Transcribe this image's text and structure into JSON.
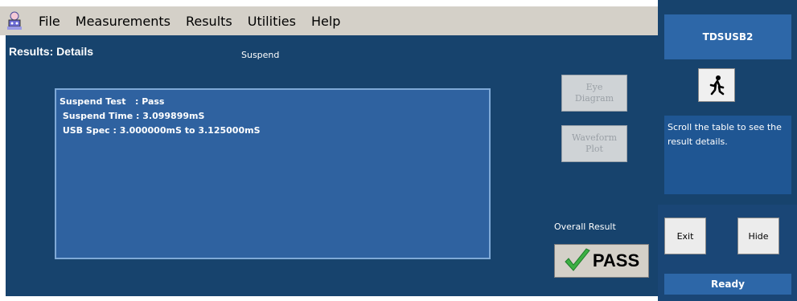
{
  "menubar": {
    "app_icon": "tektronix-robot-icon",
    "items": [
      "File",
      "Measurements",
      "Results",
      "Utilities",
      "Help"
    ]
  },
  "main": {
    "title": "Results: Details",
    "status_tag": "Suspend",
    "results_lines": [
      "Suspend Test   : Pass",
      " Suspend Time : 3.099899mS",
      " USB Spec : 3.000000mS to 3.125000mS"
    ],
    "eye_diagram": {
      "line1": "Eye",
      "line2": "Diagram"
    },
    "waveform_plot": {
      "line1": "Waveform",
      "line2": "Plot"
    },
    "overall_label": "Overall Result",
    "overall_value": "PASS"
  },
  "right_panel": {
    "app_name": "TDSUSB2",
    "run_icon": "running-man-icon",
    "help_text": "Scroll the table to see the result details.",
    "exit_label": "Exit",
    "hide_label": "Hide",
    "status": "Ready"
  },
  "colors": {
    "main_bg": "#17436d",
    "results_box_bg": "#2f62a0",
    "accent_bar": "#2d67a8",
    "pass_check": "#3cb043"
  }
}
